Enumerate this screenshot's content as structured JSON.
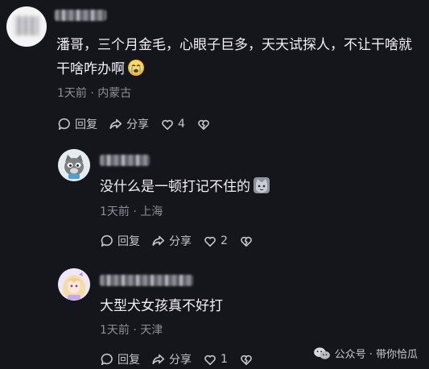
{
  "comments": [
    {
      "text_line1": "潘哥，三个月金毛，心眼子巨多，天天试探人，不让干啥就",
      "text_line2": "干啥咋办啊",
      "emoji": "crying-face",
      "meta": "1天前 · 内蒙古",
      "reply_label": "回复",
      "share_label": "分享",
      "likes": "4"
    },
    {
      "text": "没什么是一顿打记不住的",
      "emoji": "cat-face",
      "meta": "1天前 · 上海",
      "reply_label": "回复",
      "share_label": "分享",
      "likes": "2"
    },
    {
      "text": "大型犬女孩真不好打",
      "meta": "1天前 · 天津",
      "reply_label": "回复",
      "share_label": "分享",
      "likes": "1"
    }
  ],
  "watermark": {
    "text": "公众号 · 带你恰瓜"
  },
  "colors": {
    "background": "#15161b",
    "text": "#f1f1f5",
    "meta": "#8e8f97",
    "icon": "#c4c5cc"
  }
}
